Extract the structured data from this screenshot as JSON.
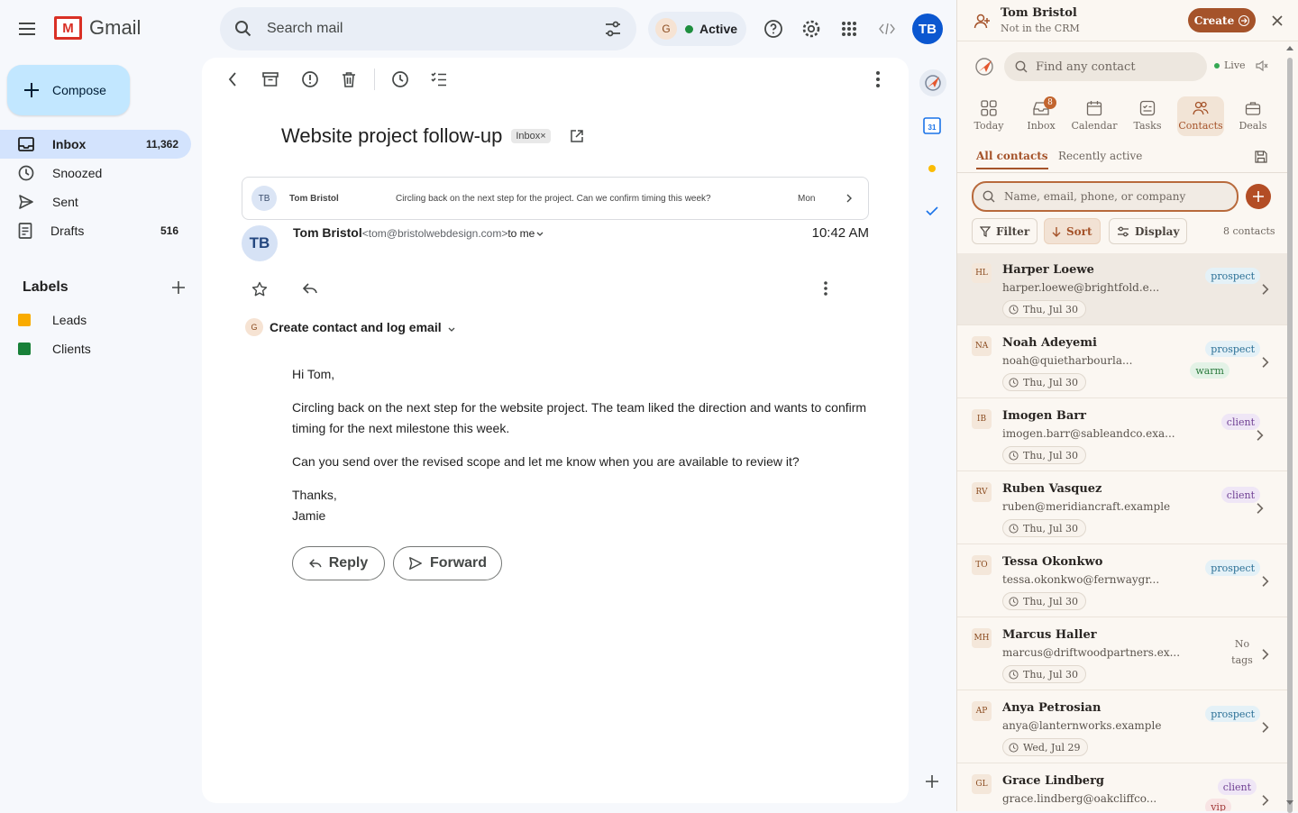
{
  "app": {
    "name": "Gmail",
    "logo_letter": "M"
  },
  "search": {
    "placeholder": "Search mail"
  },
  "status": {
    "initial": "G",
    "label": "Active",
    "color": "#1e8e3e"
  },
  "user": {
    "initials": "TB"
  },
  "compose": {
    "label": "Compose"
  },
  "nav": [
    {
      "label": "Inbox",
      "count": "11,362",
      "icon": "inbox-icon"
    },
    {
      "label": "Snoozed",
      "count": "",
      "icon": "clock-icon"
    },
    {
      "label": "Sent",
      "count": "",
      "icon": "send-icon"
    },
    {
      "label": "Drafts",
      "count": "516",
      "icon": "draft-icon"
    }
  ],
  "labels": {
    "heading": "Labels",
    "items": [
      {
        "label": "Leads",
        "color": "#f9ab00"
      },
      {
        "label": "Clients",
        "color": "#188038"
      }
    ]
  },
  "email": {
    "subject": "Website project follow-up",
    "chip": "Inbox×",
    "thread": {
      "initials": "TB",
      "sender": "Tom Bristol",
      "snippet": "Circling back on the next step for the project. Can we confirm timing this week?",
      "date": "Mon"
    },
    "sender_initials": "TB",
    "sender_name": "Tom Bristol",
    "sender_email": "<tom@bristolwebdesign.com>",
    "to": "to me",
    "time": "10:42 AM",
    "crm_action": {
      "initial": "G",
      "label": "Create contact and log email"
    },
    "body": {
      "greeting": "Hi Tom,",
      "p1": "Circling back on the next step for the website project. The team liked the direction and wants to confirm timing for the next milestone this week.",
      "p2": "Can you send over the revised scope and let me know when you are available to review it?",
      "signoff": "Thanks,",
      "signature": "Jamie"
    },
    "reply_label": "Reply",
    "forward_label": "Forward"
  },
  "crm": {
    "header": {
      "name": "Tom Bristol",
      "status": "Not in the CRM",
      "create_label": "Create"
    },
    "search_placeholder": "Find any contact",
    "live_label": "Live",
    "tabs": [
      {
        "label": "Today"
      },
      {
        "label": "Inbox",
        "badge": "8"
      },
      {
        "label": "Calendar"
      },
      {
        "label": "Tasks"
      },
      {
        "label": "Contacts"
      },
      {
        "label": "Deals"
      }
    ],
    "subtabs": {
      "all": "All contacts",
      "recent": "Recently active"
    },
    "contact_search_placeholder": "Name, email, phone, or company",
    "filter_label": "Filter",
    "sort_label": "Sort",
    "display_label": "Display",
    "count": "8 contacts",
    "contacts": [
      {
        "initials": "HL",
        "name": "Harper Loewe",
        "email": "harper.loewe@brightfold.e...",
        "date": "Thu, Jul 30",
        "tags": [
          "prospect"
        ]
      },
      {
        "initials": "NA",
        "name": "Noah Adeyemi",
        "email": "noah@quietharbourla...",
        "date": "Thu, Jul 30",
        "tags": [
          "prospect",
          "warm"
        ]
      },
      {
        "initials": "IB",
        "name": "Imogen Barr",
        "email": "imogen.barr@sableandco.exa...",
        "date": "Thu, Jul 30",
        "tags": [
          "client"
        ]
      },
      {
        "initials": "RV",
        "name": "Ruben Vasquez",
        "email": "ruben@meridiancraft.example",
        "date": "Thu, Jul 30",
        "tags": [
          "client"
        ]
      },
      {
        "initials": "TO",
        "name": "Tessa Okonkwo",
        "email": "tessa.okonkwo@fernwaygr...",
        "date": "Thu, Jul 30",
        "tags": [
          "prospect"
        ]
      },
      {
        "initials": "MH",
        "name": "Marcus Haller",
        "email": "marcus@driftwoodpartners.ex...",
        "date": "Thu, Jul 30",
        "tags": [
          "No tags"
        ]
      },
      {
        "initials": "AP",
        "name": "Anya Petrosian",
        "email": "anya@lanternworks.example",
        "date": "Wed, Jul 29",
        "tags": [
          "prospect"
        ]
      },
      {
        "initials": "GL",
        "name": "Grace Lindberg",
        "email": "grace.lindberg@oakcliffco...",
        "date": "",
        "tags": [
          "client",
          "vip"
        ]
      }
    ]
  }
}
